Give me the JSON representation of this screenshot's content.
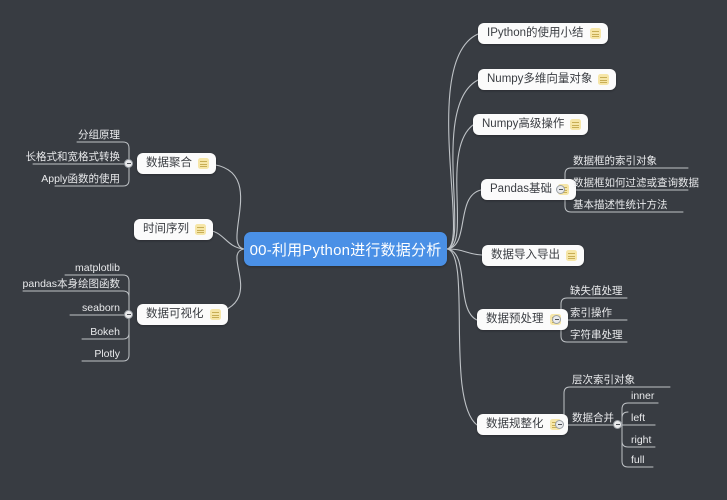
{
  "canvas": {
    "background_color": "#383c42",
    "node_color": "#fbfbfb",
    "node_text_color": "#3a3d42",
    "central_color": "#4a90e6",
    "central_text_color": "#ffffff",
    "link_color": "#bfc3c7",
    "leaf_text_color": "#e9eaec",
    "note_icon_color": "#f6e6a8"
  },
  "central": {
    "label": "00-利用Python进行数据分析"
  },
  "branches": {
    "ipython": {
      "label": "IPython的使用小结",
      "icon": "note-icon"
    },
    "numpy_vector": {
      "label": "Numpy多维向量对象",
      "icon": "note-icon"
    },
    "numpy_advanced": {
      "label": "Numpy高级操作",
      "icon": "note-icon"
    },
    "pandas_basics": {
      "label": "Pandas基础",
      "icon": "note-icon",
      "children": [
        "数据框的索引对象",
        "数据框如何过滤或查询数据",
        "基本描述性统计方法"
      ]
    },
    "data_io": {
      "label": "数据导入导出",
      "icon": "note-icon"
    },
    "preprocessing": {
      "label": "数据预处理",
      "icon": "note-icon",
      "children": [
        "缺失值处理",
        "索引操作",
        "字符串处理"
      ]
    },
    "reshaping": {
      "label": "数据规整化",
      "icon": "note-icon",
      "children": [
        "层次索引对象",
        "数据合并"
      ],
      "merge_children": [
        "inner",
        "left",
        "right",
        "full"
      ]
    },
    "aggregation": {
      "label": "数据聚合",
      "icon": "note-icon",
      "children": [
        "分组原理",
        "长格式和宽格式转换",
        "Apply函数的使用"
      ]
    },
    "timeseries": {
      "label": "时间序列",
      "icon": "note-icon"
    },
    "visualization": {
      "label": "数据可视化",
      "icon": "note-icon",
      "children": [
        "matplotlib",
        "pandas本身绘图函数",
        "seaborn",
        "Bokeh",
        "Plotly"
      ]
    }
  }
}
